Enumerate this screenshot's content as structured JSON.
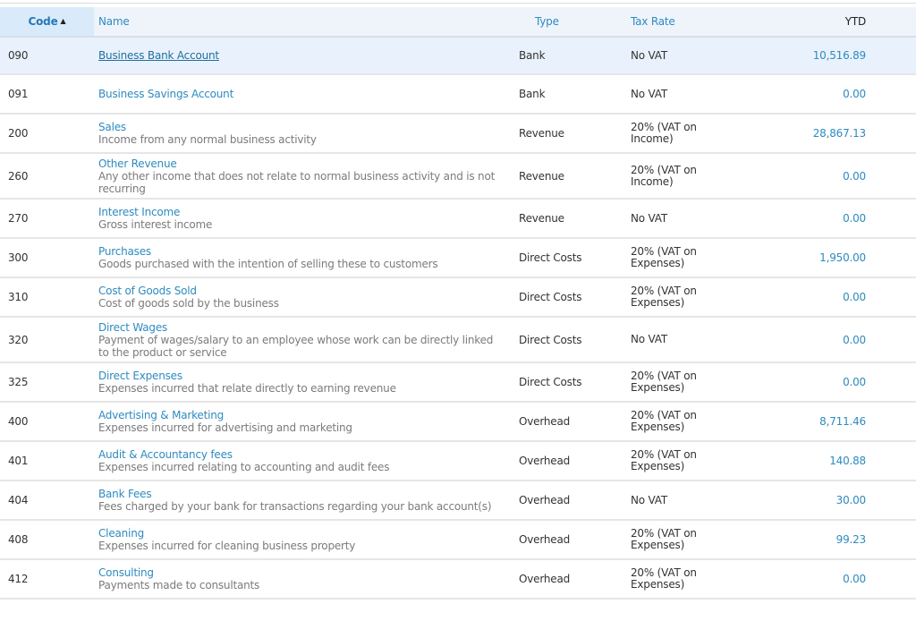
{
  "table": {
    "columns": {
      "code": "Code",
      "name": "Name",
      "type": "Type",
      "tax_rate": "Tax Rate",
      "ytd": "YTD"
    },
    "sort": {
      "column": "code",
      "direction": "ascending",
      "icon": "sort-asc-icon"
    },
    "rows": [
      {
        "code": "090",
        "name": "Business Bank Account",
        "description": "",
        "type": "Bank",
        "tax_rate": "No VAT",
        "ytd": "10,516.89",
        "selected": true
      },
      {
        "code": "091",
        "name": "Business Savings Account",
        "description": "",
        "type": "Bank",
        "tax_rate": "No VAT",
        "ytd": "0.00"
      },
      {
        "code": "200",
        "name": "Sales",
        "description": "Income from any normal business activity",
        "type": "Revenue",
        "tax_rate": "20% (VAT on Income)",
        "ytd": "28,867.13"
      },
      {
        "code": "260",
        "name": "Other Revenue",
        "description": "Any other income that does not relate to normal business activity and is not recurring",
        "type": "Revenue",
        "tax_rate": "20% (VAT on Income)",
        "ytd": "0.00"
      },
      {
        "code": "270",
        "name": "Interest Income",
        "description": "Gross interest income",
        "type": "Revenue",
        "tax_rate": "No VAT",
        "ytd": "0.00"
      },
      {
        "code": "300",
        "name": "Purchases",
        "description": "Goods purchased with the intention of selling these to customers",
        "type": "Direct Costs",
        "tax_rate": "20% (VAT on Expenses)",
        "ytd": "1,950.00"
      },
      {
        "code": "310",
        "name": "Cost of Goods Sold",
        "description": "Cost of goods sold by the business",
        "type": "Direct Costs",
        "tax_rate": "20% (VAT on Expenses)",
        "ytd": "0.00"
      },
      {
        "code": "320",
        "name": "Direct Wages",
        "description": "Payment of wages/salary to an employee whose work can be directly linked to the product or service",
        "type": "Direct Costs",
        "tax_rate": "No VAT",
        "ytd": "0.00"
      },
      {
        "code": "325",
        "name": "Direct Expenses",
        "description": "Expenses incurred that relate directly to earning revenue",
        "type": "Direct Costs",
        "tax_rate": "20% (VAT on Expenses)",
        "ytd": "0.00"
      },
      {
        "code": "400",
        "name": "Advertising & Marketing",
        "description": "Expenses incurred for advertising and marketing",
        "type": "Overhead",
        "tax_rate": "20% (VAT on Expenses)",
        "ytd": "8,711.46"
      },
      {
        "code": "401",
        "name": "Audit & Accountancy fees",
        "description": "Expenses incurred relating to accounting and audit fees",
        "type": "Overhead",
        "tax_rate": "20% (VAT on Expenses)",
        "ytd": "140.88"
      },
      {
        "code": "404",
        "name": "Bank Fees",
        "description": "Fees charged by your bank for transactions regarding your bank account(s)",
        "type": "Overhead",
        "tax_rate": "No VAT",
        "ytd": "30.00"
      },
      {
        "code": "408",
        "name": "Cleaning",
        "description": "Expenses incurred for cleaning business property",
        "type": "Overhead",
        "tax_rate": "20% (VAT on Expenses)",
        "ytd": "99.23"
      },
      {
        "code": "412",
        "name": "Consulting",
        "description": "Payments made to consultants",
        "type": "Overhead",
        "tax_rate": "20% (VAT on Expenses)",
        "ytd": "0.00"
      }
    ]
  },
  "colors": {
    "link": "#2e8bc0",
    "header_bg": "#eff4fb",
    "sorted_header_bg": "#d9ebfa",
    "selected_row_bg": "#e9f2fc"
  }
}
